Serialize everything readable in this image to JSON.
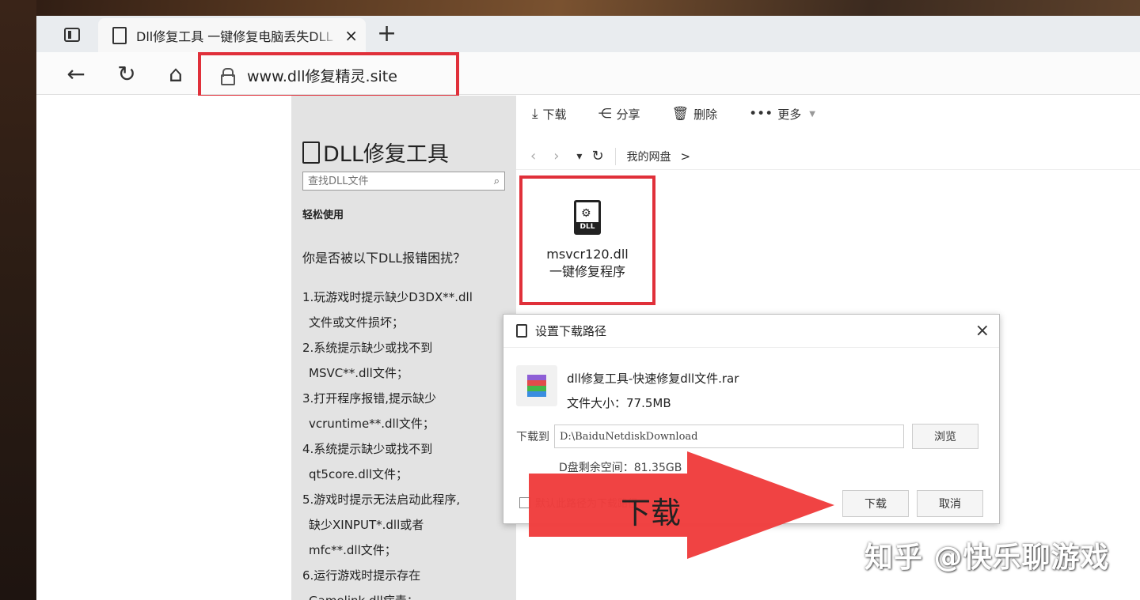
{
  "browser": {
    "tab": {
      "title": "Dll修复工具 一键修复电脑丢失DLL",
      "close_glyph": "×"
    },
    "new_tab_glyph": "+",
    "nav": {
      "back_glyph": "←",
      "refresh_glyph": "↻",
      "home_glyph": "⌂"
    },
    "address": {
      "url": "www.dll修复精灵.site"
    }
  },
  "site_sidebar": {
    "logo_text": "DLL修复工具",
    "logo_icon_tag": "DLL",
    "search_placeholder": "查找DLL文件",
    "easy_use": "轻松使用",
    "question": "你是否被以下DLL报错困扰？",
    "issues": [
      "1.玩游戏时提示缺少D3DX**.dll",
      "文件或文件损坏；",
      "2.系统提示缺少或找不到",
      "MSVC**.dll文件；",
      "3.打开程序报错,提示缺少",
      "vcruntime**.dll文件；",
      "4.系统提示缺少或找不到",
      "qt5core.dll文件；",
      "5.游戏时提示无法启动此程序,",
      "缺少XINPUT*.dll或者",
      "mfc**.dll文件；",
      "6.运行游戏时提示存在",
      "Gamelink.dll病毒；"
    ]
  },
  "netdisk": {
    "toolbar": {
      "download": "下载",
      "share": "分享",
      "delete": "删除",
      "more": "更多"
    },
    "breadcrumb": {
      "root": "我的网盘",
      "sep": ">"
    },
    "file": {
      "icon_tag": "DLL",
      "name_line1": "msvcr120.dll",
      "name_line2": "一键修复程序"
    }
  },
  "dialog": {
    "title": "设置下载路径",
    "close_glyph": "×",
    "file_name": "dll修复工具-快速修复dll文件.rar",
    "file_size": "文件大小：77.5MB",
    "save_to_label": "下载到",
    "save_path": "D:\\BaiduNetdiskDownload",
    "browse": "浏览",
    "free_space": "D盘剩余空间：81.35GB",
    "remember": "默认此路径为下载路径",
    "download": "下载",
    "cancel": "取消"
  },
  "annotation": {
    "arrow_text": "下载",
    "arrow_color": "#ef3b3b",
    "highlight_color": "#e0303a"
  },
  "watermark": "知乎 @快乐聊游戏"
}
